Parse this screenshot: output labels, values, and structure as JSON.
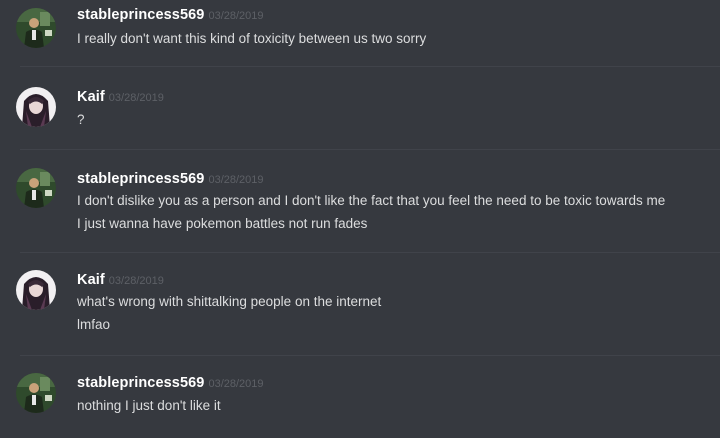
{
  "messages": [
    {
      "author": "stableprincess569",
      "timestamp": "03/28/2019",
      "avatar_icon": "man-suit-avatar-icon",
      "lines": [
        "I really don't want this kind of toxicity between us two sorry"
      ]
    },
    {
      "author": "Kaif",
      "timestamp": "03/28/2019",
      "avatar_icon": "anime-girl-avatar-icon",
      "lines": [
        "?"
      ]
    },
    {
      "author": "stableprincess569",
      "timestamp": "03/28/2019",
      "avatar_icon": "man-suit-avatar-icon",
      "lines": [
        "I don't dislike you as a person and I don't like the fact that you feel the need to be toxic towards me",
        "I just wanna have pokemon battles not run fades"
      ]
    },
    {
      "author": "Kaif",
      "timestamp": "03/28/2019",
      "avatar_icon": "anime-girl-avatar-icon",
      "lines": [
        "what's wrong with shittalking people on the internet",
        "lmfao"
      ]
    },
    {
      "author": "stableprincess569",
      "timestamp": "03/28/2019",
      "avatar_icon": "man-suit-avatar-icon",
      "lines": [
        "nothing I just don't like it"
      ]
    }
  ],
  "colors": {
    "background": "#36393f",
    "username": "#ffffff",
    "message_text": "#dcddde",
    "timestamp": "#5d6066",
    "divider": "#40434a"
  }
}
